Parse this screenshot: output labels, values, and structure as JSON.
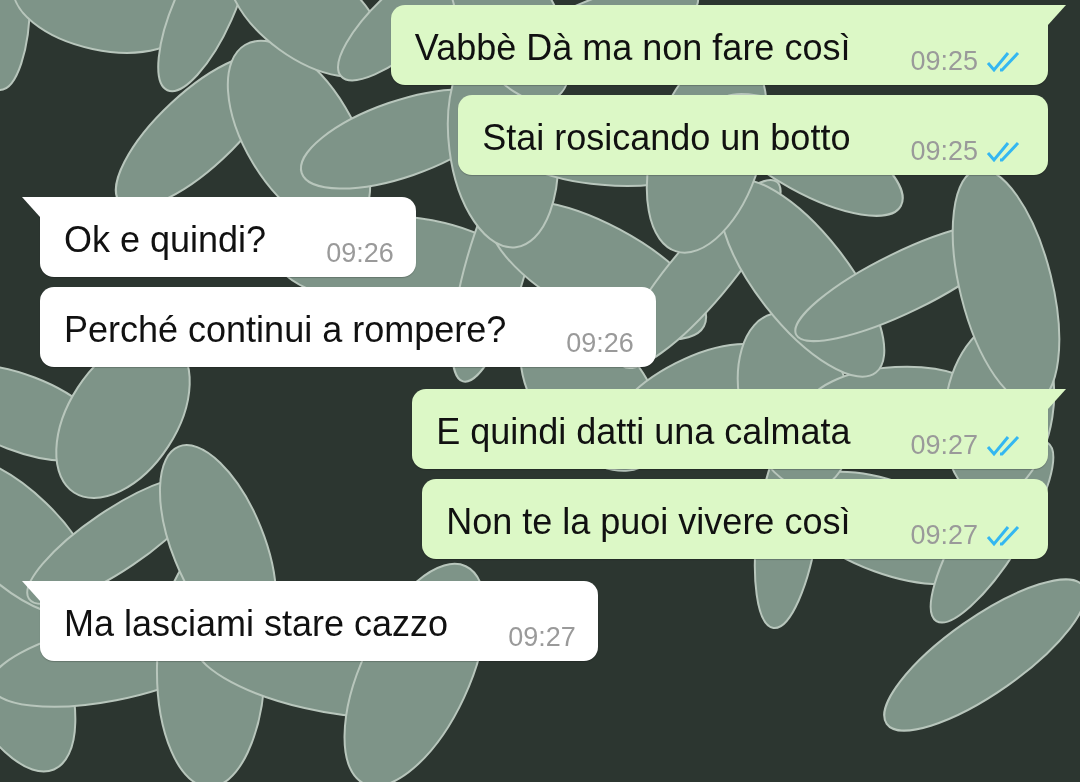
{
  "messages": [
    {
      "kind": "out",
      "text": "Vabbè Dà ma non fare così",
      "time": "09:25",
      "read": true
    },
    {
      "kind": "out",
      "text": "Stai rosicando un botto",
      "time": "09:25",
      "read": true
    },
    {
      "kind": "in",
      "text": "Ok e quindi?",
      "time": "09:26"
    },
    {
      "kind": "in",
      "text": "Perché continui a rompere?",
      "time": "09:26"
    },
    {
      "kind": "out",
      "text": "E quindi datti una calmata",
      "time": "09:27",
      "read": true
    },
    {
      "kind": "out",
      "text": "Non te la puoi vivere così",
      "time": "09:27",
      "read": true
    },
    {
      "kind": "in",
      "text": "Ma lasciami stare cazzo",
      "time": "09:27"
    }
  ]
}
